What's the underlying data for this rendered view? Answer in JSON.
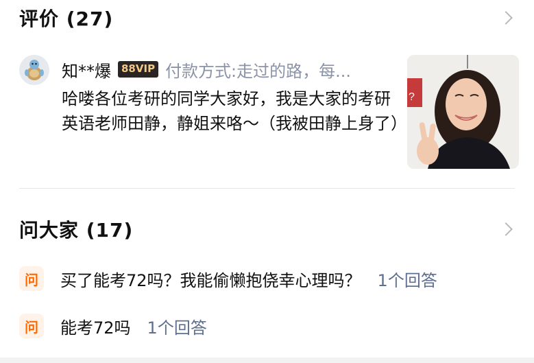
{
  "reviews": {
    "title": "评价 (27)",
    "items": [
      {
        "user_name": "知**爆",
        "vip_badge": "88VIP",
        "purchase_info": "付款方式:走过的路，每...",
        "text": "哈喽各位考研的同学大家好，我是大家的考研英语老师田静，静姐来咯～（我被田静上身了）"
      }
    ]
  },
  "qa": {
    "title": "问大家 (17)",
    "items": [
      {
        "badge": "问",
        "question": "买了能考72吗？我能偷懒抱侥幸心理吗？",
        "answers": "1个回答"
      },
      {
        "badge": "问",
        "question": "能考72吗",
        "answers": "1个回答"
      }
    ]
  },
  "colors": {
    "accent_orange": "#ff6a00",
    "vip_gold": "#f2c98a",
    "muted_text": "#8b93a7",
    "answer_link": "#5f6f8f"
  },
  "icons": [
    "chevron-right-icon",
    "chevron-right-icon"
  ]
}
